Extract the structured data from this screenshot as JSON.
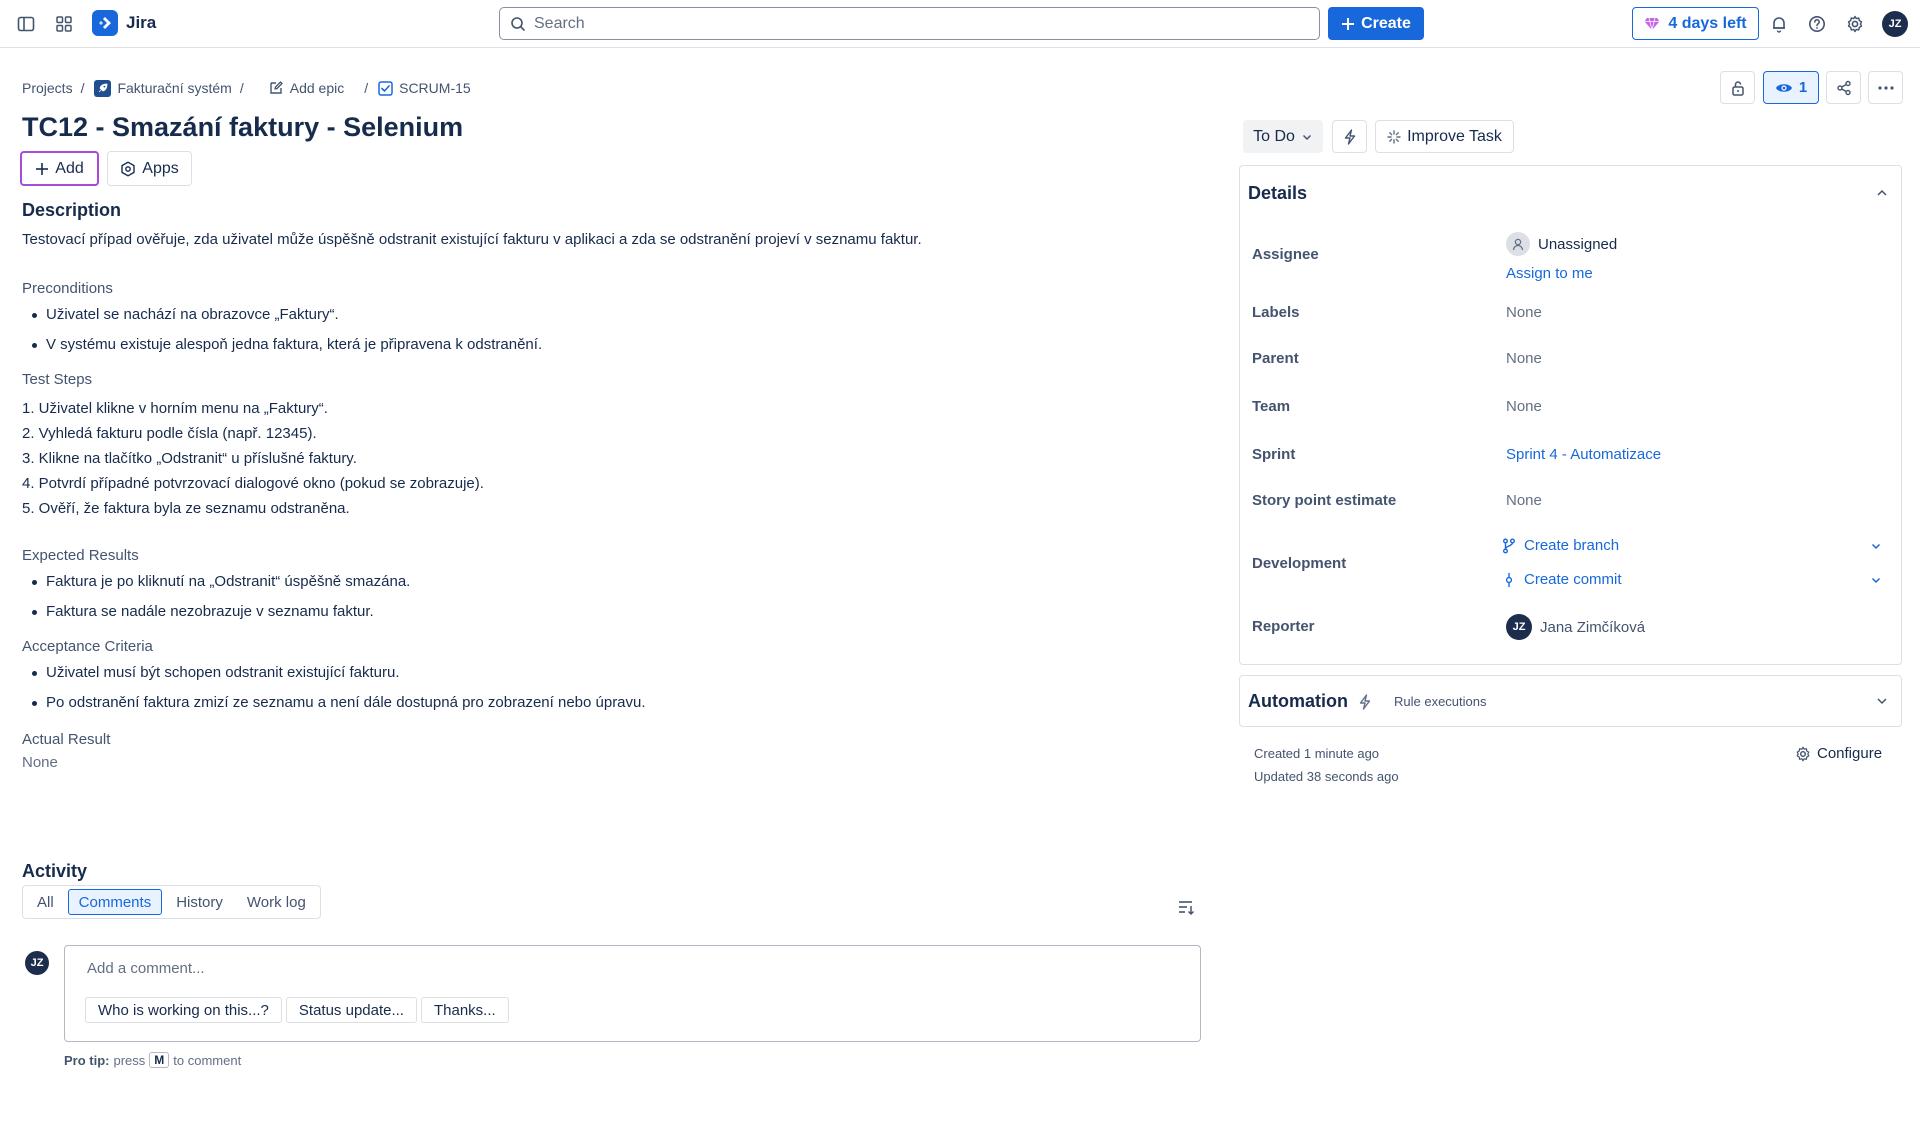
{
  "topnav": {
    "app_name": "Jira",
    "search_placeholder": "Search",
    "create_label": "Create",
    "trial_label": "4 days left",
    "user_initials": "JZ"
  },
  "breadcrumb": {
    "projects": "Projects",
    "project_name": "Fakturační systém",
    "add_epic": "Add epic",
    "issue_key": "SCRUM-15"
  },
  "issue": {
    "title": "TC12 - Smazání faktury - Selenium",
    "add_label": "Add",
    "apps_label": "Apps"
  },
  "description": {
    "heading": "Description",
    "intro": "Testovací případ ověřuje, zda uživatel může úspěšně odstranit existující fakturu v aplikaci a zda se odstranění projeví v seznamu faktur.",
    "preconditions_title": "Preconditions",
    "preconditions": [
      "Uživatel se nachází na obrazovce „Faktury“.",
      "V systému existuje alespoň jedna faktura, která je připravena k odstranění."
    ],
    "steps_title": "Test Steps",
    "steps": [
      "1. Uživatel klikne v horním menu na „Faktury“.",
      "2. Vyhledá fakturu podle čísla (např. 12345).",
      "3. Klikne na tlačítko „Odstranit“ u příslušné faktury.",
      "4. Potvrdí případné potvrzovací dialogové okno (pokud se zobrazuje).",
      "5. Ověří, že faktura byla ze seznamu odstraněna."
    ],
    "expected_title": "Expected Results",
    "expected": [
      "Faktura je po kliknutí na „Odstranit“ úspěšně smazána.",
      "Faktura se nadále nezobrazuje v seznamu faktur."
    ],
    "acceptance_title": "Acceptance Criteria",
    "acceptance": [
      "Uživatel musí být schopen odstranit existující fakturu.",
      "Po odstranění faktura zmizí ze seznamu a není dále dostupná pro zobrazení nebo úpravu."
    ],
    "actual_title": "Actual Result",
    "actual_value": "None"
  },
  "activity": {
    "title": "Activity",
    "tabs": [
      "All",
      "Comments",
      "History",
      "Work log"
    ],
    "active_tab": "Comments",
    "comment_placeholder": "Add a comment...",
    "chips": [
      "Who is working on this...?",
      "Status update...",
      "Thanks..."
    ],
    "protip_label": "Pro tip:",
    "protip_press": "press",
    "protip_key": "M",
    "protip_suffix": "to comment",
    "avatar_initials": "JZ"
  },
  "side": {
    "watch_count": "1",
    "status_label": "To Do",
    "improve_label": "Improve Task",
    "details_title": "Details",
    "rows": {
      "assignee_label": "Assignee",
      "assignee_value": "Unassigned",
      "assign_to_me": "Assign to me",
      "labels_label": "Labels",
      "labels_value": "None",
      "parent_label": "Parent",
      "parent_value": "None",
      "team_label": "Team",
      "team_value": "None",
      "sprint_label": "Sprint",
      "sprint_value": "Sprint 4 - Automatizace",
      "story_label": "Story point estimate",
      "story_value": "None",
      "development_label": "Development",
      "create_branch": "Create branch",
      "create_commit": "Create commit",
      "reporter_label": "Reporter",
      "reporter_value": "Jana Zimčíková",
      "reporter_initials": "JZ"
    },
    "automation_title": "Automation",
    "rule_executions": "Rule executions",
    "created": "Created 1 minute ago",
    "updated": "Updated 38 seconds ago",
    "configure_label": "Configure"
  },
  "colors": {
    "primary": "#1868db",
    "add_border": "#a54dd6",
    "text": "#172b4d",
    "subtle": "#44546f"
  }
}
